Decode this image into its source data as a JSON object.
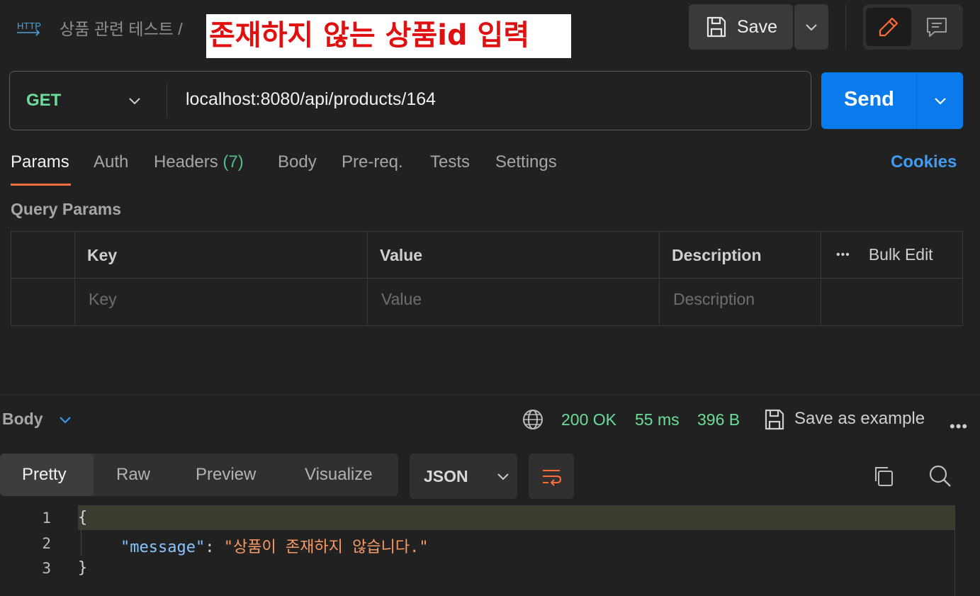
{
  "header": {
    "protocol_icon_label": "HTTP",
    "breadcrumb_collection": "상품 관련 테스트",
    "breadcrumb_separator": "/",
    "annotation": "존재하지 않는 상품id 입력",
    "save_label": "Save"
  },
  "request": {
    "method": "GET",
    "url": "localhost:8080/api/products/164",
    "send_label": "Send"
  },
  "tabs": {
    "params": "Params",
    "auth": "Auth",
    "headers": "Headers",
    "headers_count": "(7)",
    "body": "Body",
    "prereq": "Pre-req.",
    "tests": "Tests",
    "settings": "Settings",
    "cookies": "Cookies"
  },
  "query_params": {
    "title": "Query Params",
    "col_key": "Key",
    "col_value": "Value",
    "col_description": "Description",
    "more": "•••",
    "bulk_edit": "Bulk Edit",
    "ph_key": "Key",
    "ph_value": "Value",
    "ph_description": "Description"
  },
  "response": {
    "body_label": "Body",
    "status": "200 OK",
    "time": "55 ms",
    "size": "396 B",
    "save_example": "Save as example",
    "more": "•••",
    "views": {
      "pretty": "Pretty",
      "raw": "Raw",
      "preview": "Preview",
      "visualize": "Visualize"
    },
    "format": "JSON",
    "lines": [
      {
        "n": "1",
        "open": "{"
      },
      {
        "n": "2",
        "key": "\"message\"",
        "colon": ": ",
        "value": "\"상품이 존재하지 않습니다.\""
      },
      {
        "n": "3",
        "close": "}"
      }
    ]
  },
  "colors": {
    "accent_send": "#097bed",
    "method_get": "#6bdd9a",
    "tab_underline": "#ff6c37",
    "cookies_link": "#3f9cf5",
    "annotation_text": "#e01010"
  }
}
